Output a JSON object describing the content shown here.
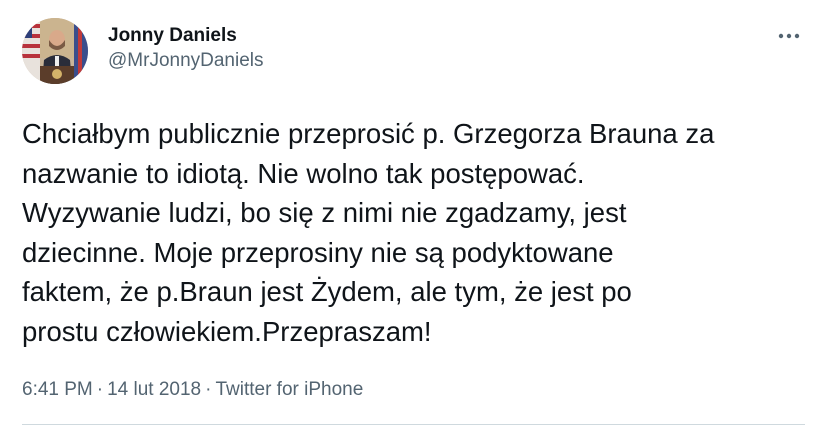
{
  "author": {
    "display_name": "Jonny Daniels",
    "handle": "@MrJonnyDaniels",
    "avatar_icon": "profile-photo"
  },
  "tweet": {
    "text": "Chciałbym publicznie przeprosić p. Grzegorza Brauna za\nnazwanie to idiotą. Nie wolno tak postępować.\nWyzywanie ludzi, bo się z nimi nie zgadzamy, jest\ndziecinne. Moje przeprosiny nie są podyktowane\nfaktem, że p.Braun jest Żydem, ale tym, że jest po\nprostu człowiekiem.Przepraszam!"
  },
  "meta": {
    "time": "6:41 PM",
    "separator": "·",
    "date": "14 lut 2018",
    "source": "Twitter for iPhone"
  },
  "more_icon": "more-horizontal-icon",
  "colors": {
    "text": "#0f1419",
    "secondary": "#536471",
    "divider": "#cfd9de"
  }
}
